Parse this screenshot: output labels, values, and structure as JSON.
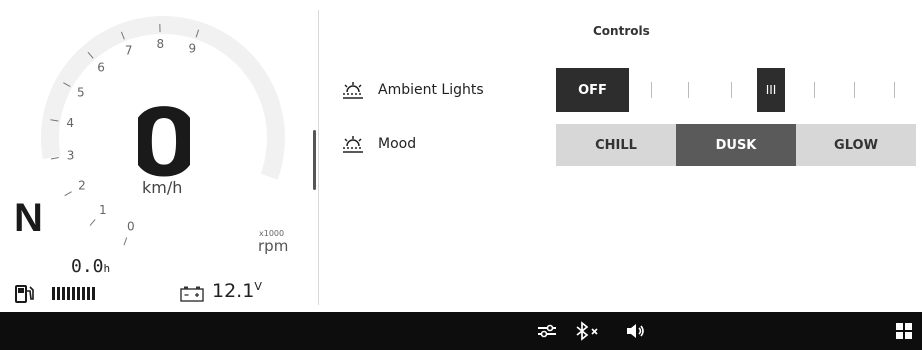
{
  "dashboard": {
    "speed": "0",
    "speed_unit": "km/h",
    "gear": "N",
    "tach_labels": [
      "0",
      "1",
      "2",
      "3",
      "4",
      "5",
      "6",
      "7",
      "8",
      "9"
    ],
    "rpm_multiplier": "x1000",
    "rpm_unit": "rpm",
    "trip_value": "0.0",
    "trip_unit": "h",
    "fuel_bars": 9,
    "voltage_value": "12.1",
    "voltage_unit": "V"
  },
  "controls": {
    "title": "Controls",
    "ambient_lights": {
      "label": "Ambient Lights",
      "icon": "ambient-light-icon",
      "off_label": "OFF",
      "thumb_label": "III",
      "level": 0.5
    },
    "mood": {
      "label": "Mood",
      "icon": "ambient-light-icon",
      "options": [
        "CHILL",
        "DUSK",
        "GLOW"
      ],
      "selected": "DUSK"
    }
  },
  "bottom_bar": {
    "icons": [
      "settings-sliders-icon",
      "bluetooth-off-icon",
      "volume-icon",
      "apps-grid-icon"
    ]
  },
  "colors": {
    "dark": "#2d2d2d",
    "active_option": "#5a5a5a",
    "inactive_option": "#d7d7d7",
    "bottom_bar": "#0d0d0d"
  }
}
